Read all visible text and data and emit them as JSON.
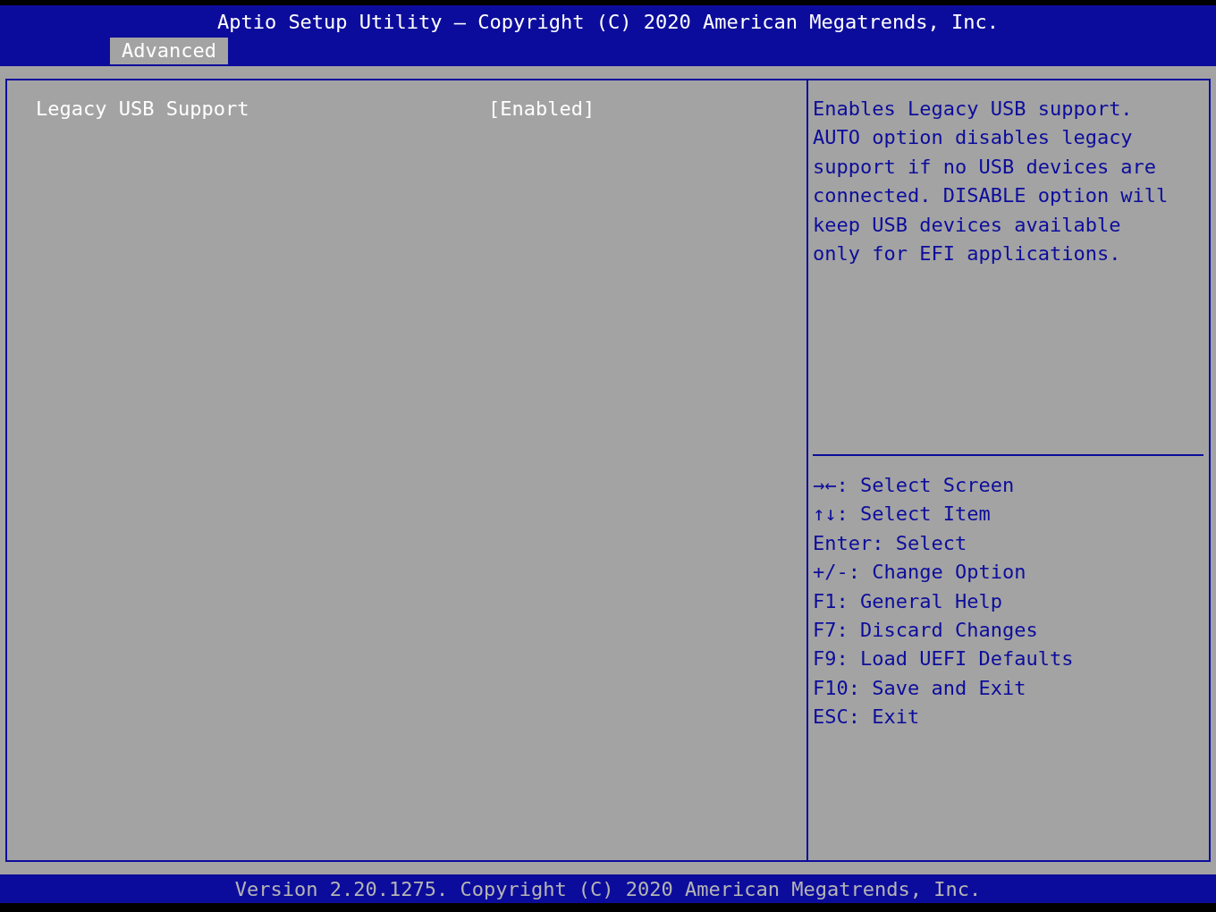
{
  "header": {
    "title": "Aptio Setup Utility – Copyright (C) 2020 American Megatrends, Inc.",
    "tabs": [
      {
        "label": "Advanced",
        "selected": true
      }
    ]
  },
  "settings": [
    {
      "label": "Legacy USB Support",
      "value": "[Enabled]"
    }
  ],
  "help": {
    "description": [
      "Enables Legacy USB support.",
      "AUTO option disables legacy",
      "support if no USB devices are",
      "connected. DISABLE option will",
      "keep USB devices available",
      "only for EFI applications."
    ],
    "keys": [
      "→←: Select Screen",
      "↑↓: Select Item",
      "Enter: Select",
      "+/-: Change Option",
      "F1: General Help",
      "F7: Discard Changes",
      "F9: Load UEFI Defaults",
      "F10: Save and Exit",
      "ESC: Exit"
    ]
  },
  "footer": {
    "text": "Version 2.20.1275. Copyright (C) 2020 American Megatrends, Inc."
  }
}
